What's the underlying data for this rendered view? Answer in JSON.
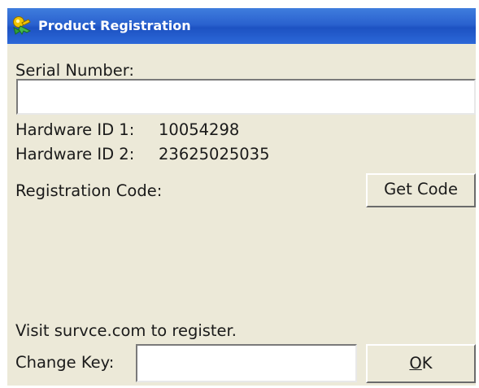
{
  "window": {
    "title": "Product Registration",
    "icon": "registration-key-icon"
  },
  "serial": {
    "label": "Serial Number:",
    "value": ""
  },
  "hardware": {
    "id1_label": "Hardware ID 1:",
    "id1_value": "10054298",
    "id2_label": "Hardware ID 2:",
    "id2_value": "23625025035"
  },
  "registration": {
    "label": "Registration Code:",
    "get_code_label": "Get Code",
    "code": ""
  },
  "footer": {
    "visit_text": "Visit survce.com to register.",
    "change_key_label": "Change Key:",
    "change_key_value": "",
    "ok_accel": "O",
    "ok_rest": "K"
  },
  "colors": {
    "dialog_background": "#ece9d8",
    "titlebar": "#2a62cf",
    "title_text": "#ffffff"
  }
}
